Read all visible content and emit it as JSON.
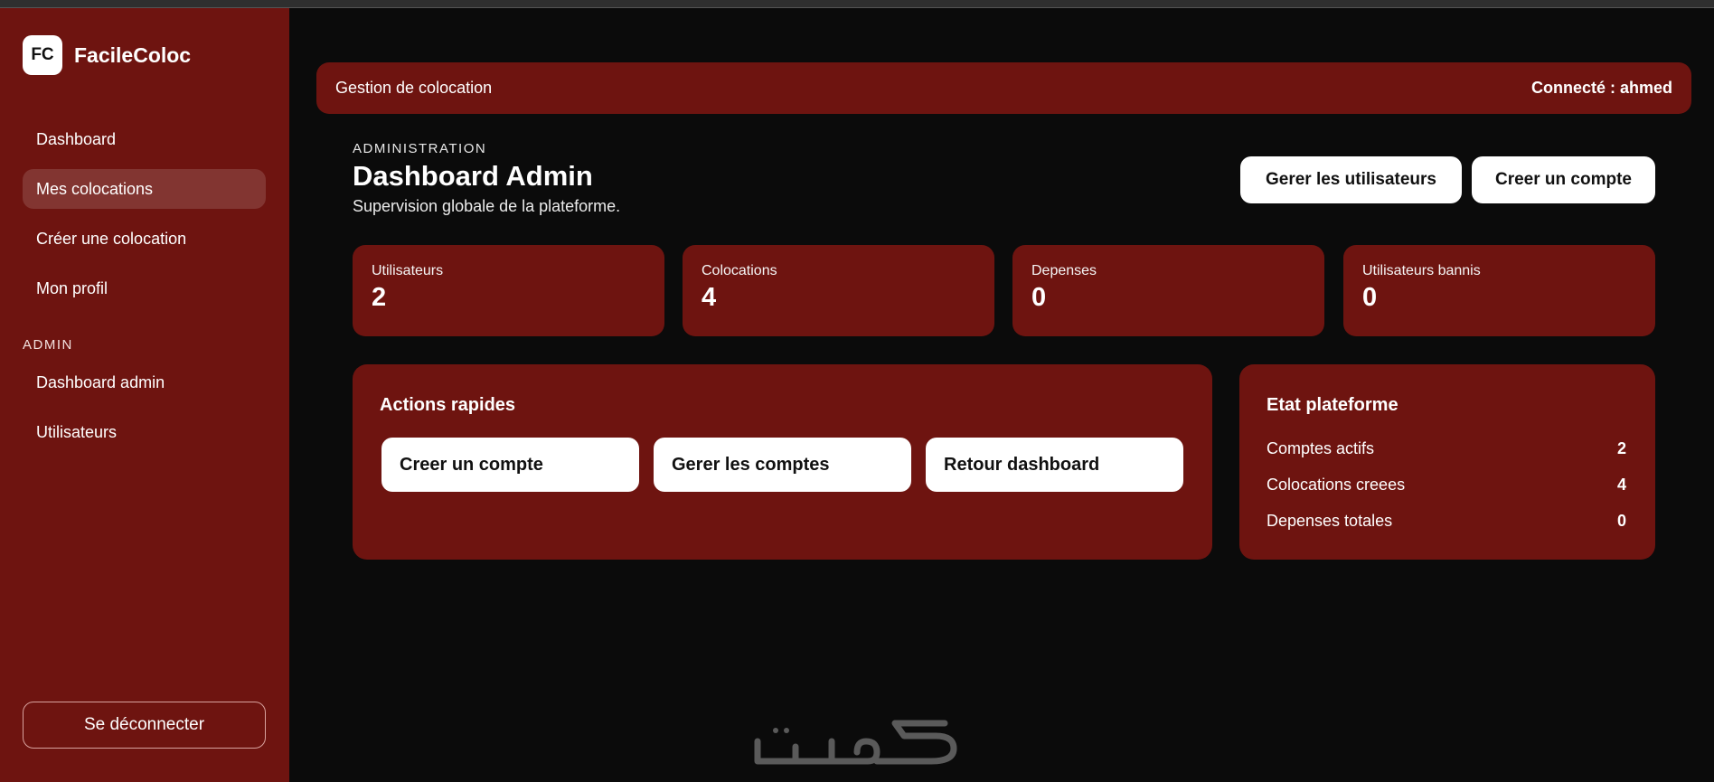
{
  "brand": {
    "logo": "FC",
    "name": "FacileColoc"
  },
  "sidebar": {
    "items": [
      {
        "label": "Dashboard"
      },
      {
        "label": "Mes colocations"
      },
      {
        "label": "Créer une colocation"
      },
      {
        "label": "Mon profil"
      }
    ],
    "admin_label": "ADMIN",
    "admin_items": [
      {
        "label": "Dashboard admin"
      },
      {
        "label": "Utilisateurs"
      }
    ],
    "logout": "Se déconnecter"
  },
  "header": {
    "title": "Gestion de colocation",
    "user": "Connecté : ahmed"
  },
  "page": {
    "eyebrow": "ADMINISTRATION",
    "title": "Dashboard Admin",
    "subtitle": "Supervision globale de la plateforme.",
    "btn_manage_users": "Gerer les utilisateurs",
    "btn_create_account": "Creer un compte"
  },
  "stats": [
    {
      "label": "Utilisateurs",
      "value": "2"
    },
    {
      "label": "Colocations",
      "value": "4"
    },
    {
      "label": "Depenses",
      "value": "0"
    },
    {
      "label": "Utilisateurs bannis",
      "value": "0"
    }
  ],
  "quick_actions": {
    "title": "Actions rapides",
    "buttons": [
      {
        "label": "Creer un compte"
      },
      {
        "label": "Gerer les comptes"
      },
      {
        "label": "Retour dashboard"
      }
    ]
  },
  "platform_state": {
    "title": "Etat plateforme",
    "rows": [
      {
        "label": "Comptes actifs",
        "value": "2"
      },
      {
        "label": "Colocations creees",
        "value": "4"
      },
      {
        "label": "Depenses totales",
        "value": "0"
      }
    ]
  },
  "colors": {
    "accent": "#6e1410",
    "background": "#0b0b0b",
    "surface_light": "#ffffff"
  }
}
